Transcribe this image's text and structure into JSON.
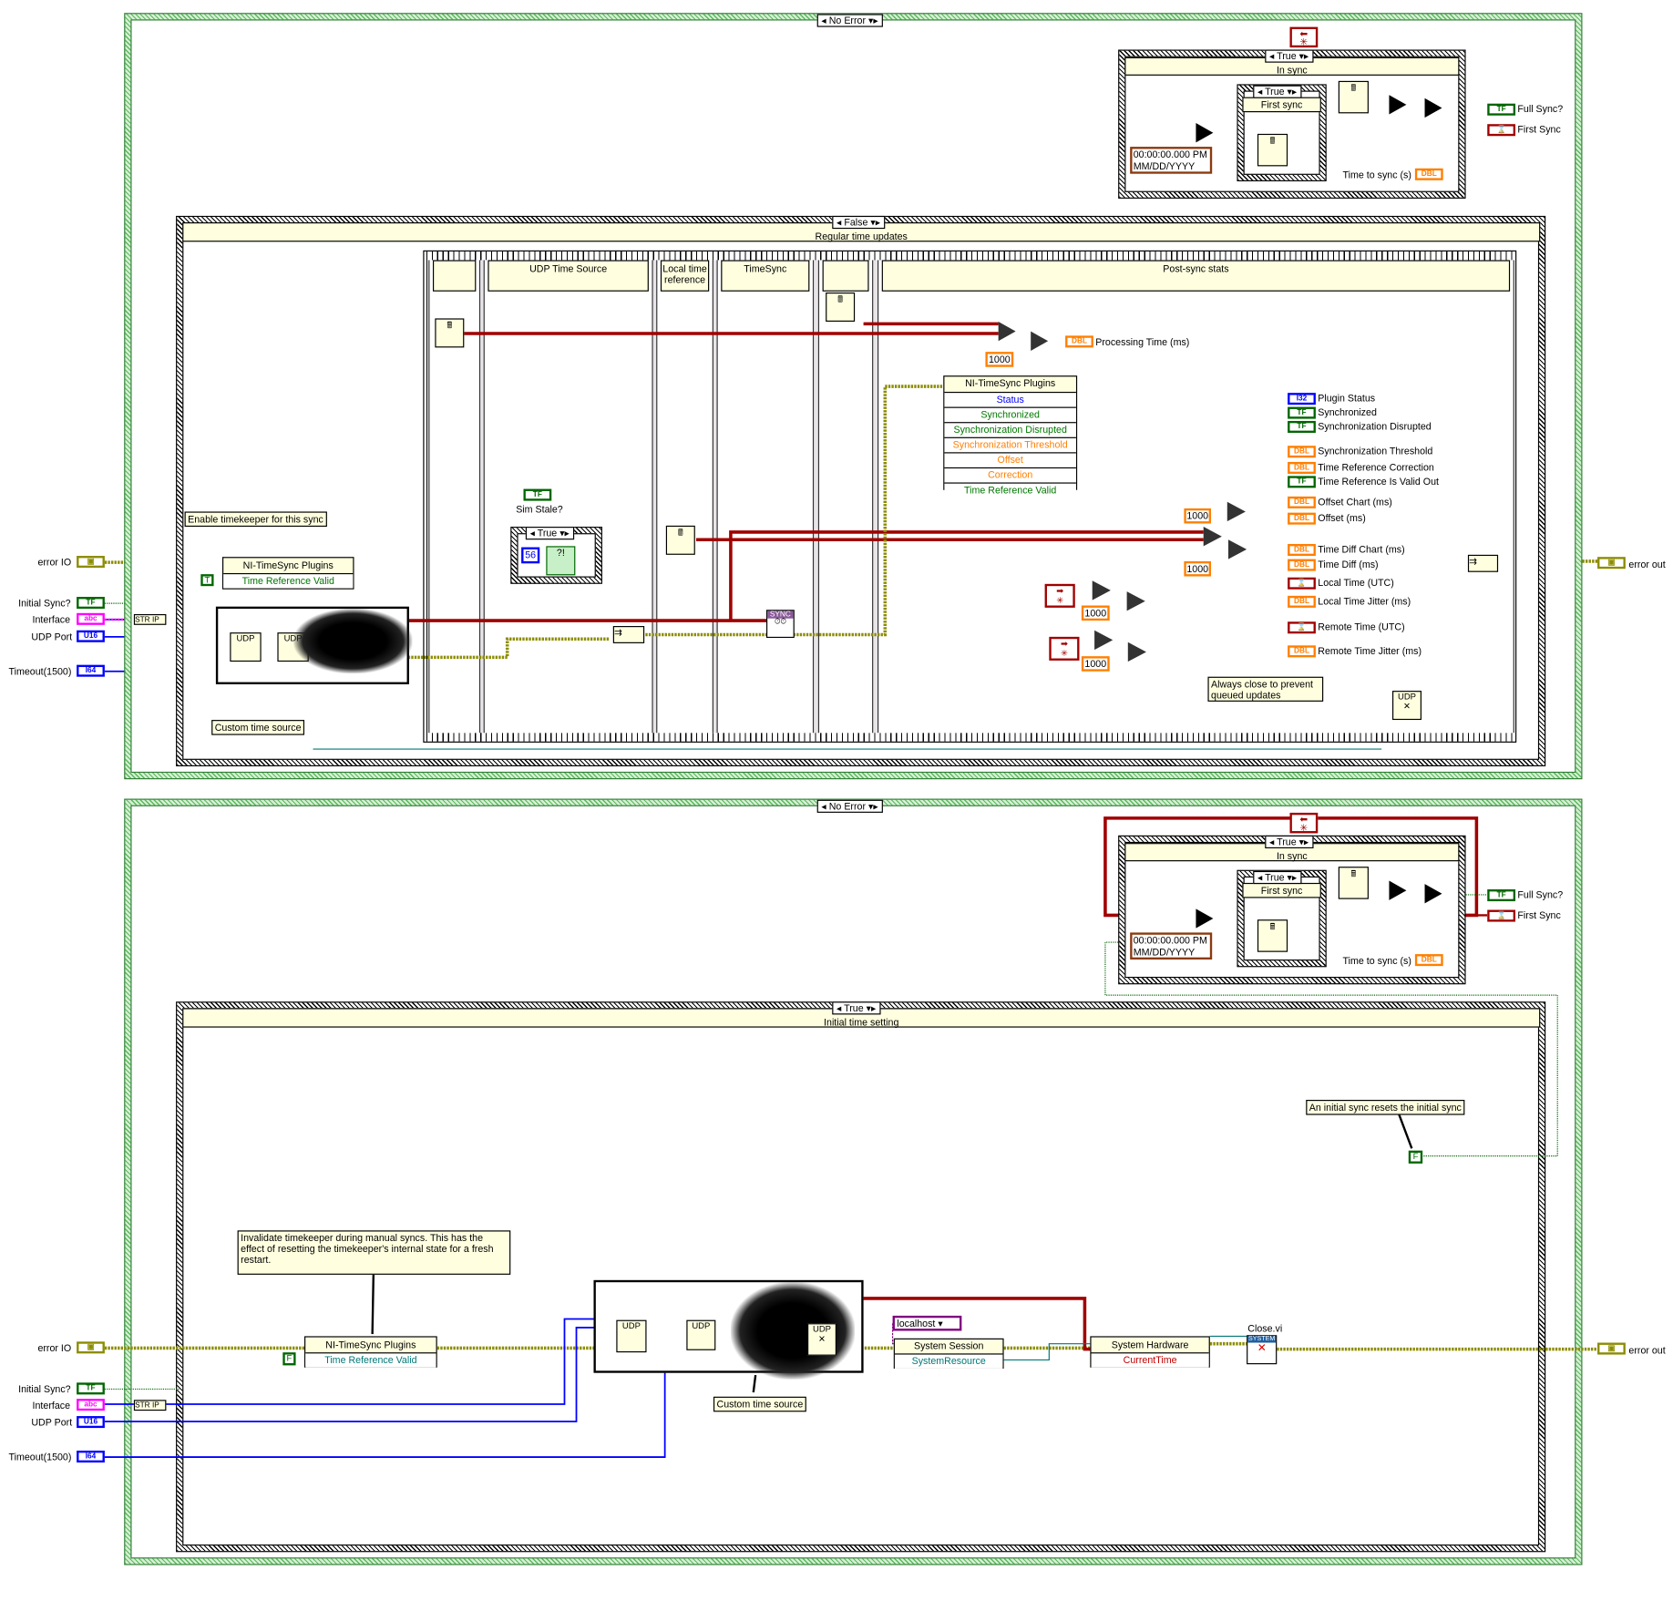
{
  "colors": {
    "error_wire": "#8c8c00",
    "timestamp_wire": "#a00000",
    "dbl_wire": "#ff7f00",
    "int_wire": "#0000ff",
    "bool_wire": "#006600",
    "refnum_wire": "#007878",
    "string_wire": "#ff00ff",
    "case_border": "#5cb85c"
  },
  "outer_case_selector": "No Error",
  "sync_status": {
    "in_sync_selector": "True",
    "in_sync_header": "In sync",
    "first_sync_selector": "True",
    "first_sync_header": "First sync",
    "timestamp_const_line1": "00:00:00.000 PM",
    "timestamp_const_line2": "MM/DD/YYYY",
    "time_to_sync_label": "Time to sync (s)",
    "time_to_sync_type": "DBL",
    "full_sync_label": "Full Sync?",
    "full_sync_type": "TF",
    "first_sync_label": "First Sync",
    "feedback_icon": "feedback-node-icon"
  },
  "inputs": {
    "error_io": "error IO",
    "initial_sync": "Initial Sync?",
    "interface": "Interface",
    "udp_port": "UDP Port",
    "timeout": "Timeout(1500)",
    "type_tf": "TF",
    "type_abc": "abc",
    "type_u16": "U16",
    "type_i64": "I64",
    "str_ip": "STR IP",
    "error_out": "error out"
  },
  "top": {
    "case_selector": "False",
    "case_header": "Regular time updates",
    "frames": [
      "",
      "UDP Time Source",
      "Local time reference",
      "TimeSync",
      "",
      "Post-sync stats"
    ],
    "comment_enable": "Enable timekeeper for this sync",
    "comment_custom": "Custom time source",
    "comment_close": "Always close to prevent queued updates",
    "prop_node_title": "NI-TimeSync Plugins",
    "prop_node_row": "Time Reference Valid",
    "true_const": "T",
    "sim_stale_label": "Sim Stale?",
    "sim_case_selector": "True",
    "error_code_const": "56",
    "sync_icon_label": "SYNC",
    "udp_label": "UDP",
    "processing_label": "Processing Time (ms)",
    "const_1000": "1000",
    "plugin_node": {
      "title": "NI-TimeSync Plugins",
      "rows": [
        "Status",
        "Synchronized",
        "Synchronization Disrupted",
        "Synchronization Threshold",
        "Offset",
        "Correction",
        "Time Reference Valid"
      ]
    },
    "indicators": [
      {
        "label": "Plugin Status",
        "type": "I32"
      },
      {
        "label": "Synchronized",
        "type": "TF"
      },
      {
        "label": "Synchronization Disrupted",
        "type": "TF"
      },
      {
        "label": "Synchronization Threshold",
        "type": "DBL"
      },
      {
        "label": "Time Reference Correction",
        "type": "DBL"
      },
      {
        "label": "Time Reference Is Valid Out",
        "type": "TF"
      },
      {
        "label": "Offset Chart (ms)",
        "type": "DBL"
      },
      {
        "label": "Offset (ms)",
        "type": "DBL"
      },
      {
        "label": "Time Diff Chart (ms)",
        "type": "DBL"
      },
      {
        "label": "Time Diff (ms)",
        "type": "DBL"
      },
      {
        "label": "Local Time (UTC)",
        "type": "⌛"
      },
      {
        "label": "Local Time Jitter (ms)",
        "type": "DBL"
      },
      {
        "label": "Remote Time (UTC)",
        "type": "⌛"
      },
      {
        "label": "Remote Time Jitter (ms)",
        "type": "DBL"
      }
    ]
  },
  "bottom": {
    "case_selector": "True",
    "case_header": "Initial time setting",
    "comment_initial": "An initial sync resets the initial sync",
    "false_const": "F",
    "comment_invalidate": "Invalidate timekeeper during manual syncs.  This has the effect of resetting the timekeeper's internal state for a fresh restart.",
    "prop_node_title": "NI-TimeSync Plugins",
    "prop_node_row": "Time Reference Valid",
    "comment_custom": "Custom time source",
    "localhost": "localhost",
    "system_session_title": "System Session",
    "system_session_row": "SystemResource",
    "system_hardware_title": "System Hardware",
    "system_hardware_row": "CurrentTime",
    "close_label": "Close.vi",
    "close_icon_label": "SYSTEM",
    "udp_label": "UDP"
  }
}
